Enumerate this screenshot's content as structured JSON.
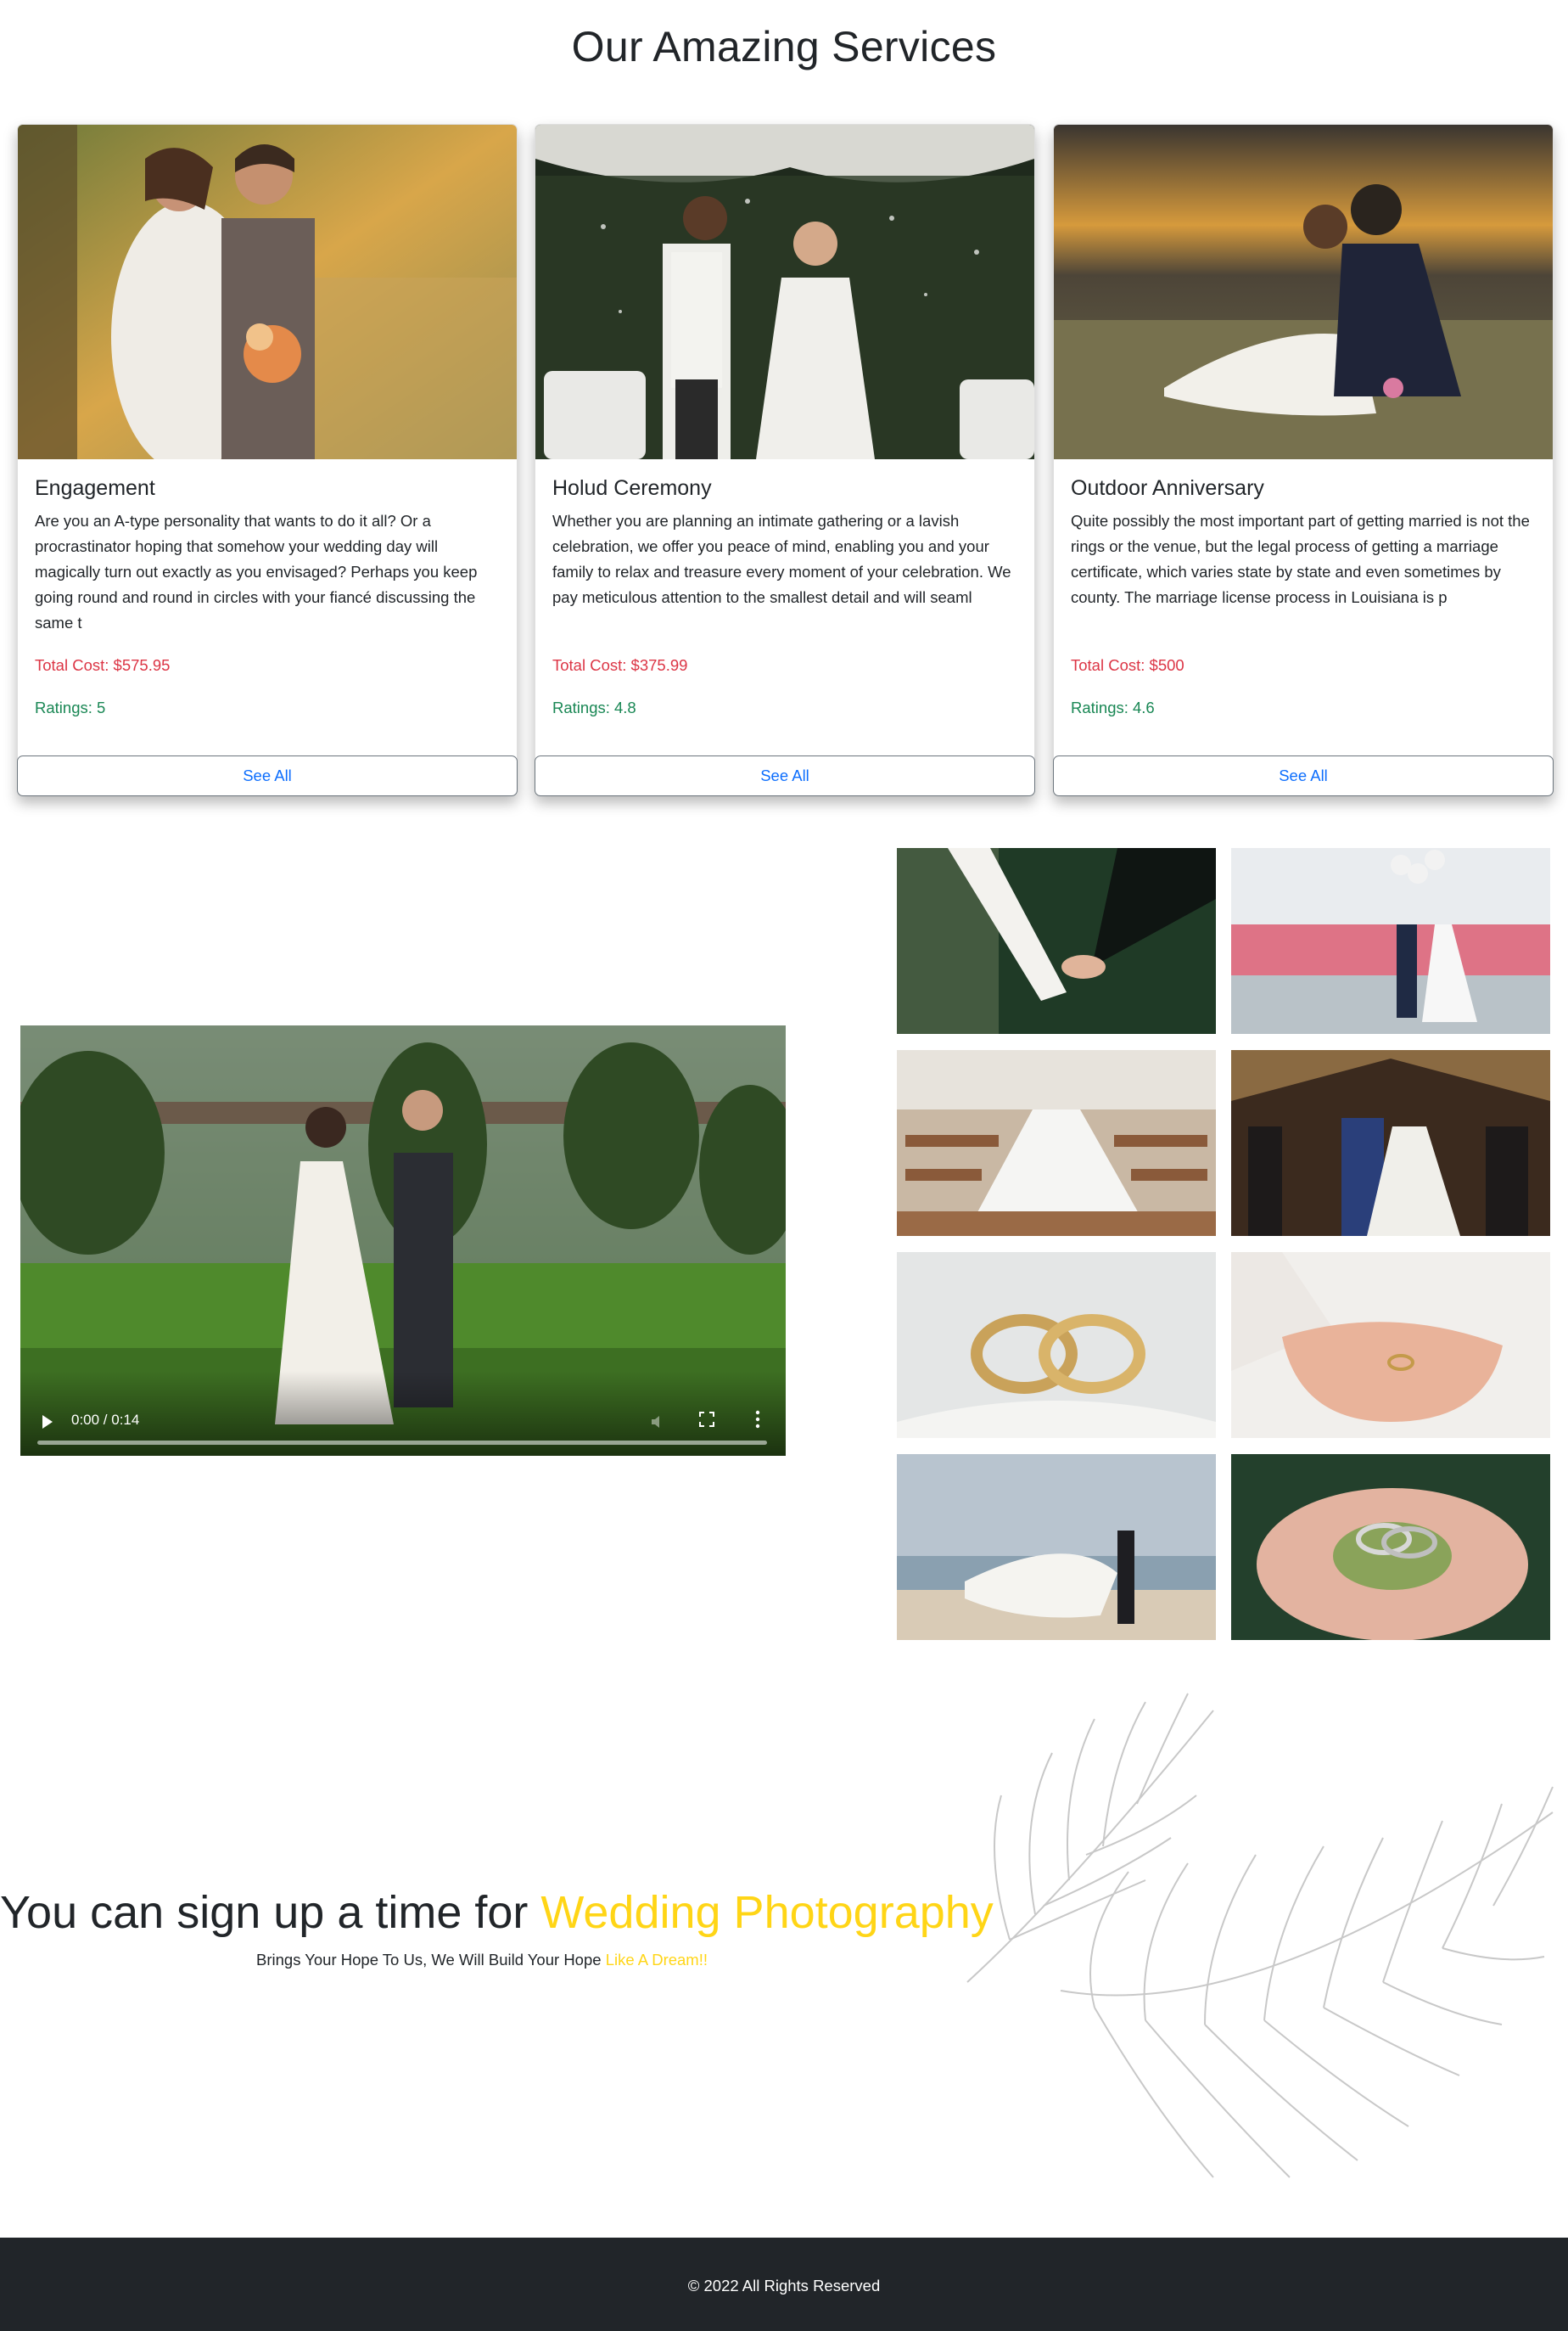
{
  "services": {
    "title": "Our Amazing Services",
    "cards": [
      {
        "title": "Engagement",
        "description": "Are you an A-type personality that wants to do it all? Or a procrastinator hoping that somehow your wedding day will magically turn out exactly as you envisaged? Perhaps you keep going round and round in circles with your fiancé discussing the same t",
        "cost": "Total Cost: $575.95",
        "rating": "Ratings: 5",
        "button": "See All"
      },
      {
        "title": "Holud Ceremony",
        "description": "Whether you are planning an intimate gathering or a lavish celebration, we offer you peace of mind, enabling you and your family to relax and treasure every moment of your celebration. We pay meticulous attention to the smallest detail and will seaml",
        "cost": "Total Cost: $375.99",
        "rating": "Ratings: 4.8",
        "button": "See All"
      },
      {
        "title": "Outdoor Anniversary",
        "description": "Quite possibly the most important part of getting married is not the rings or the venue, but the legal process of getting a marriage certificate, which varies state by state and even sometimes by county. The marriage license process in Louisiana is p",
        "cost": "Total Cost: $500",
        "rating": "Ratings: 4.6",
        "button": "See All"
      }
    ]
  },
  "video": {
    "time": "0:00 / 0:14",
    "progress": 0
  },
  "gallery": {
    "count_shown": 8
  },
  "signup": {
    "title_prefix": "You can sign up a time for ",
    "title_highlight": "Wedding Photography",
    "subtitle_prefix": "Brings Your Hope To Us, We Will Build Your Hope ",
    "subtitle_highlight": "Like A Dream!!"
  },
  "footer": {
    "text": "© 2022 All Rights Reserved"
  },
  "colors": {
    "accent_yellow": "#ffd516",
    "cost_red": "#dc3545",
    "rating_green": "#198754",
    "link_blue": "#0d6efd",
    "footer_bg": "#212529"
  }
}
